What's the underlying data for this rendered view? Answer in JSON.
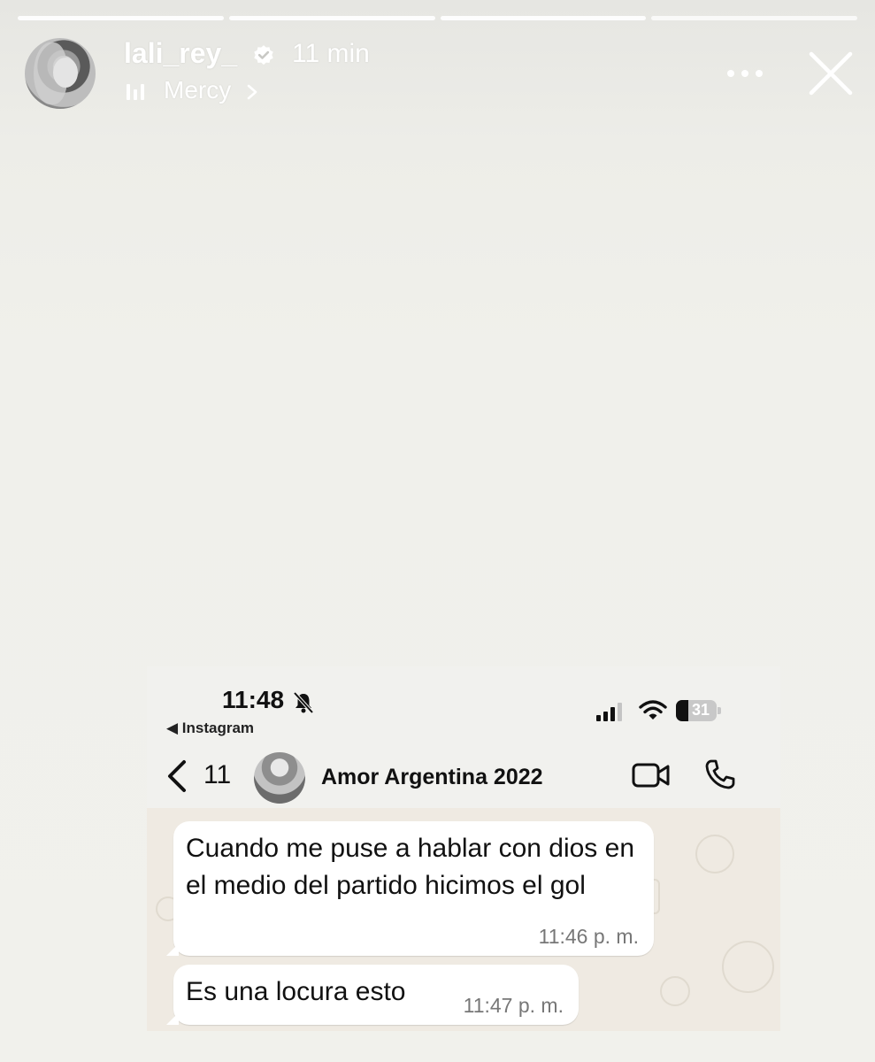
{
  "story": {
    "progress_segments": 4,
    "username": "lali_rey_",
    "verified": true,
    "time_ago": "11 min",
    "music_track": "Mercy",
    "icons": {
      "verified": "verified-badge-icon",
      "music": "music-bars-icon",
      "more": "more-dots-icon",
      "close": "close-icon"
    }
  },
  "embedded_screenshot": {
    "status_bar": {
      "time": "11:48",
      "back_app": "◀ Instagram",
      "battery": "31"
    },
    "chat_header": {
      "back_count": "11",
      "group_name": "Amor Argentina 2022"
    },
    "messages": [
      {
        "text": "Cuando me puse a hablar con dios en el medio del partido hicimos el gol",
        "time": "11:46 p. m."
      },
      {
        "text": "Es una locura esto",
        "time": "11:47 p. m."
      }
    ]
  }
}
